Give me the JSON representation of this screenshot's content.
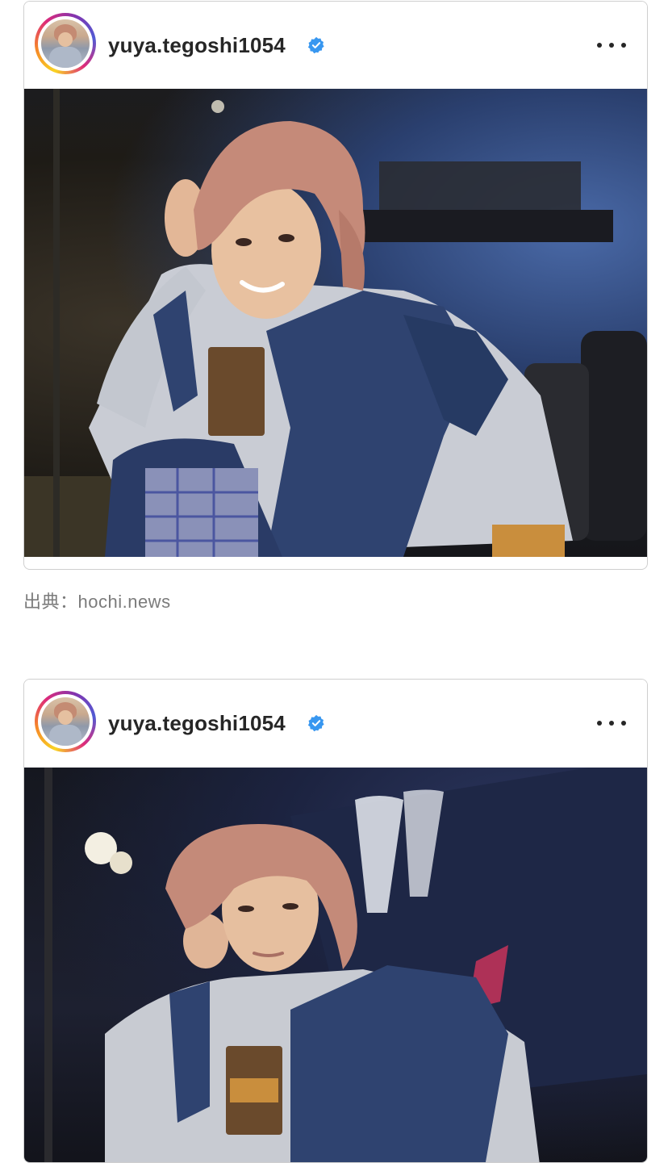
{
  "posts": [
    {
      "username": "yuya.tegoshi1054",
      "verified": true,
      "avatar_icon": "profile-avatar",
      "more_icon": "more-options-icon",
      "photo_alt": "Person with pink hair in denim outfit on stage"
    },
    {
      "username": "yuya.tegoshi1054",
      "verified": true,
      "avatar_icon": "profile-avatar",
      "more_icon": "more-options-icon",
      "photo_alt": "Person with pink hair resting head on hand on stage"
    }
  ],
  "caption": {
    "text": "出典：hochi.news"
  },
  "colors": {
    "verified_badge": "#3897f0",
    "username": "#262626",
    "caption": "#7b7b7b",
    "border": "#cfcfcf"
  }
}
